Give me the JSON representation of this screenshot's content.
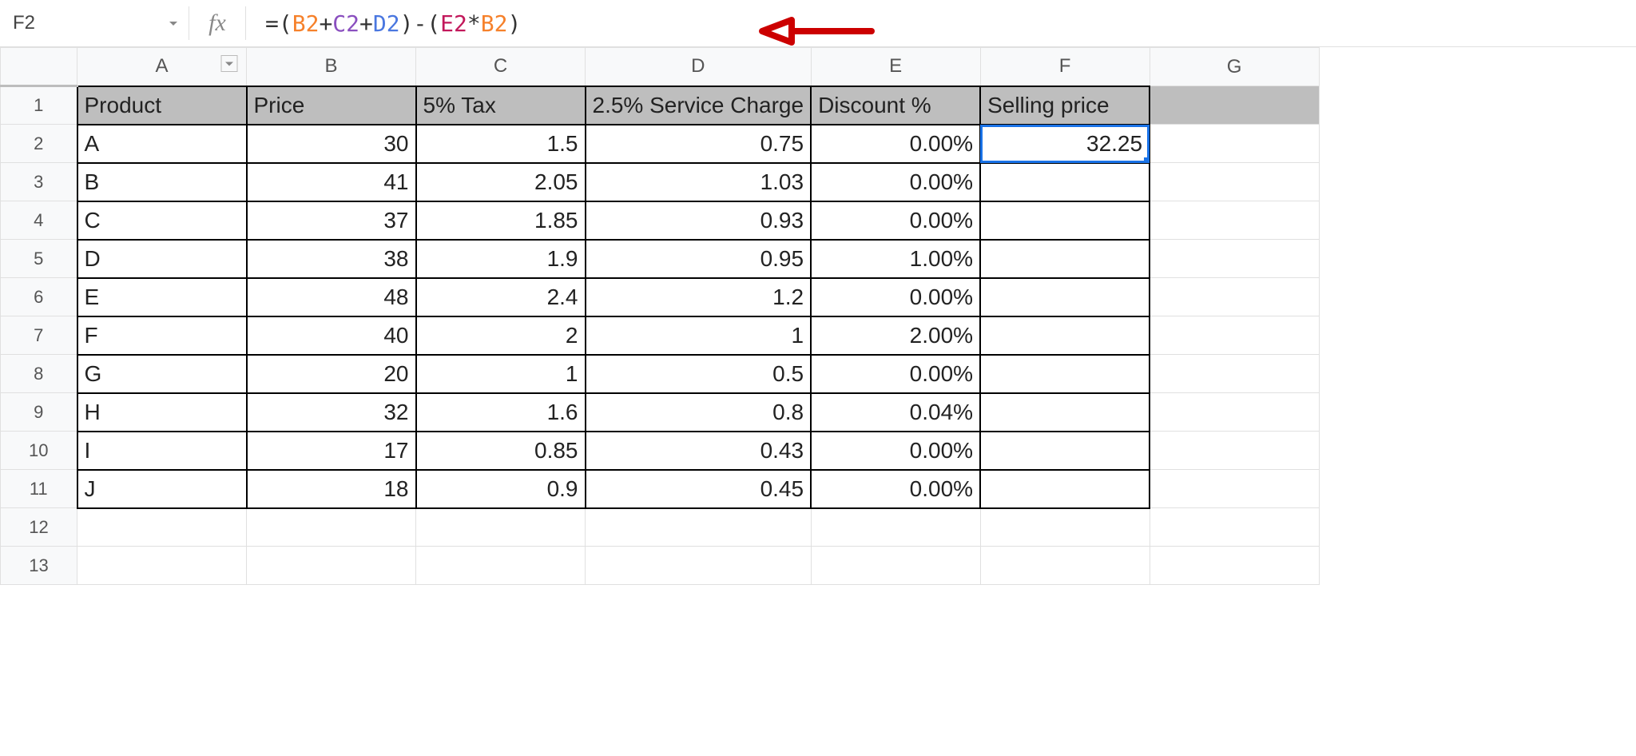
{
  "name_box": "F2",
  "fx_label": "fx",
  "formula": {
    "tokens": [
      {
        "t": "=",
        "cls": "op"
      },
      {
        "t": "(",
        "cls": "br"
      },
      {
        "t": "B2",
        "cls": "r-orange"
      },
      {
        "t": "+",
        "cls": "op"
      },
      {
        "t": "C2",
        "cls": "r-purple"
      },
      {
        "t": "+",
        "cls": "op"
      },
      {
        "t": "D2",
        "cls": "r-blue"
      },
      {
        "t": ")",
        "cls": "br"
      },
      {
        "t": "-",
        "cls": "op"
      },
      {
        "t": "(",
        "cls": "br"
      },
      {
        "t": "E2",
        "cls": "r-magenta"
      },
      {
        "t": "*",
        "cls": "op"
      },
      {
        "t": "B2",
        "cls": "r-orange"
      },
      {
        "t": ")",
        "cls": "br"
      }
    ]
  },
  "columns": [
    "A",
    "B",
    "C",
    "D",
    "E",
    "F",
    "G"
  ],
  "row_numbers": [
    1,
    2,
    3,
    4,
    5,
    6,
    7,
    8,
    9,
    10,
    11,
    12,
    13
  ],
  "headers": {
    "A": "Product",
    "B": "Price",
    "C": "5% Tax",
    "D": "2.5% Service Charge",
    "E": "Discount %",
    "F": "Selling price"
  },
  "rows": [
    {
      "A": "A",
      "B": "30",
      "C": "1.5",
      "D": "0.75",
      "E": "0.00%",
      "F": "32.25"
    },
    {
      "A": "B",
      "B": "41",
      "C": "2.05",
      "D": "1.03",
      "E": "0.00%",
      "F": ""
    },
    {
      "A": "C",
      "B": "37",
      "C": "1.85",
      "D": "0.93",
      "E": "0.00%",
      "F": ""
    },
    {
      "A": "D",
      "B": "38",
      "C": "1.9",
      "D": "0.95",
      "E": "1.00%",
      "F": ""
    },
    {
      "A": "E",
      "B": "48",
      "C": "2.4",
      "D": "1.2",
      "E": "0.00%",
      "F": ""
    },
    {
      "A": "F",
      "B": "40",
      "C": "2",
      "D": "1",
      "E": "2.00%",
      "F": ""
    },
    {
      "A": "G",
      "B": "20",
      "C": "1",
      "D": "0.5",
      "E": "0.00%",
      "F": ""
    },
    {
      "A": "H",
      "B": "32",
      "C": "1.6",
      "D": "0.8",
      "E": "0.04%",
      "F": ""
    },
    {
      "A": "I",
      "B": "17",
      "C": "0.85",
      "D": "0.43",
      "E": "0.00%",
      "F": ""
    },
    {
      "A": "J",
      "B": "18",
      "C": "0.9",
      "D": "0.45",
      "E": "0.00%",
      "F": ""
    }
  ],
  "selected_cell": "F2"
}
